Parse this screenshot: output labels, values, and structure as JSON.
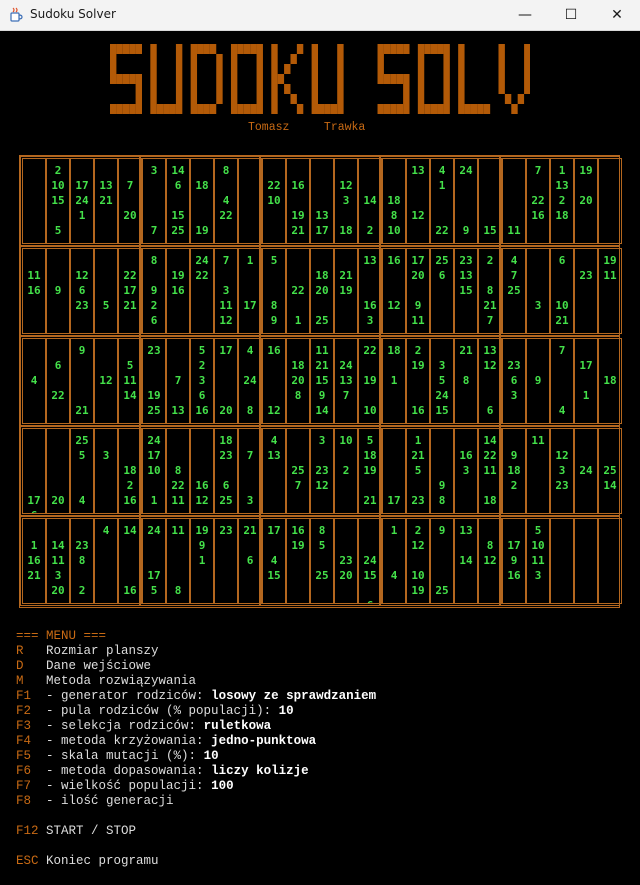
{
  "window": {
    "title": "Sudoku Solver",
    "icon": "java-cup-icon",
    "controls": {
      "minimize": "—",
      "maximize": "☐",
      "close": "✕"
    }
  },
  "banner": {
    "text": "SUDOKU SOLVER",
    "author": "Tomasz     Trawka",
    "color": "#b35a07"
  },
  "board": {
    "grid_color": "#b4671f",
    "value_color": "#44e14a",
    "rows": [
      [
        [
          [],
          [
            "2",
            "10",
            "15",
            "",
            "5"
          ],
          [
            "",
            "17",
            "24",
            "1"
          ],
          [
            "",
            "13",
            "21"
          ],
          [
            "",
            "7",
            "",
            "20"
          ],
          [
            "3",
            "",
            "",
            "",
            "7"
          ],
          [
            "14",
            "6",
            "",
            "15",
            "25"
          ],
          [
            "",
            "18",
            "",
            "",
            "19"
          ],
          [
            "8",
            "",
            "4",
            "22"
          ],
          []
        ],
        [
          [
            "",
            "22",
            "10"
          ],
          [
            "",
            "16",
            "",
            "19",
            "21"
          ],
          [
            "",
            "",
            "",
            "13",
            "17"
          ],
          [
            "",
            "12",
            "3",
            "",
            "18"
          ],
          [
            "",
            "",
            "14",
            "",
            "2"
          ],
          [
            "",
            "",
            "18",
            "8",
            "10"
          ],
          [
            "13",
            "",
            "",
            "12"
          ],
          [
            "4",
            "1",
            "",
            "",
            "22"
          ],
          [
            "24",
            "",
            "",
            "",
            "9"
          ],
          [
            "",
            "",
            "",
            "",
            "15"
          ]
        ],
        [
          [
            "",
            "",
            "",
            "",
            "11"
          ],
          [
            "7",
            "",
            "22",
            "16"
          ],
          [
            "1",
            "13",
            "2",
            "18"
          ],
          [
            "19",
            "",
            "20"
          ],
          []
        ]
      ],
      [
        [
          [
            "",
            "11",
            "16"
          ],
          [
            "",
            "",
            "9"
          ],
          [
            "",
            "12",
            "6",
            "23"
          ],
          [
            "",
            "",
            "",
            "5"
          ],
          [
            "",
            "22",
            "17",
            "21"
          ],
          [
            "8",
            "",
            "9",
            "2",
            "6"
          ],
          [
            "",
            "19",
            "16"
          ],
          [
            "24",
            "22"
          ],
          [
            "7",
            "",
            "3",
            "11",
            "12"
          ],
          [
            "1",
            "",
            "",
            "17"
          ]
        ],
        [
          [
            "5",
            "",
            "",
            "8",
            "9"
          ],
          [
            "",
            "",
            "22",
            "",
            "1"
          ],
          [
            "",
            "18",
            "20",
            "",
            "25"
          ],
          [
            "",
            "21",
            "19"
          ],
          [
            "13",
            "",
            "",
            "16",
            "3"
          ],
          [
            "16",
            "",
            "",
            "12"
          ],
          [
            "17",
            "20",
            "",
            "9",
            "11"
          ],
          [
            "25",
            "6"
          ],
          [
            "23",
            "13",
            "15"
          ],
          [
            "2",
            "",
            "8",
            "21",
            "7"
          ]
        ],
        [
          [
            "4",
            "7",
            "25"
          ],
          [
            "",
            "",
            "",
            "3"
          ],
          [
            "6",
            "",
            "",
            "10",
            "21"
          ],
          [
            "",
            "23"
          ],
          [
            "19",
            "11"
          ]
        ]
      ],
      [
        [
          [
            "",
            "",
            "4"
          ],
          [
            "",
            "6",
            "",
            "22"
          ],
          [
            "9",
            "",
            "",
            "",
            "21"
          ],
          [
            "",
            "",
            "12"
          ],
          [
            "",
            "5",
            "11",
            "14"
          ],
          [
            "23",
            "",
            "",
            "19",
            "25"
          ],
          [
            "",
            "",
            "7",
            "",
            "13"
          ],
          [
            "5",
            "2",
            "3",
            "6",
            "16"
          ],
          [
            "17",
            "",
            "",
            "",
            "20"
          ],
          [
            "4",
            "",
            "24",
            "",
            "8"
          ]
        ],
        [
          [
            "16",
            "",
            "",
            "",
            "12"
          ],
          [
            "",
            "18",
            "20",
            "8"
          ],
          [
            "11",
            "21",
            "15",
            "9",
            "14"
          ],
          [
            "",
            "24",
            "13",
            "7"
          ],
          [
            "22",
            "",
            "19",
            "",
            "10"
          ],
          [
            "18",
            "",
            "1"
          ],
          [
            "2",
            "19",
            "",
            "",
            "16"
          ],
          [
            "",
            "3",
            "5",
            "24",
            "15"
          ],
          [
            "21",
            "",
            "8"
          ],
          [
            "13",
            "12",
            "",
            "",
            "6"
          ]
        ],
        [
          [
            "",
            "23",
            "6",
            "3"
          ],
          [
            "",
            "",
            "9"
          ],
          [
            "7",
            "",
            "",
            "",
            "4"
          ],
          [
            "",
            "17",
            "",
            "1"
          ],
          [
            "",
            "",
            "18"
          ]
        ]
      ],
      [
        [
          [
            "",
            "",
            "",
            "",
            "17",
            "6"
          ],
          [
            "",
            "",
            "",
            "",
            "20"
          ],
          [
            "25",
            "5",
            "",
            "",
            "4"
          ],
          [
            "",
            "3"
          ],
          [
            "",
            "",
            "18",
            "2",
            "16"
          ],
          [
            "24",
            "17",
            "10",
            "",
            "1"
          ],
          [
            "",
            "",
            "8",
            "22",
            "11"
          ],
          [
            "",
            "",
            "",
            "16",
            "12"
          ],
          [
            "18",
            "23",
            "",
            "6",
            "25"
          ],
          [
            "",
            "7",
            "",
            "",
            "3"
          ]
        ],
        [
          [
            "4",
            "13"
          ],
          [
            "",
            "",
            "25",
            "7"
          ],
          [
            "3",
            "",
            "23",
            "12"
          ],
          [
            "10",
            "",
            "2"
          ],
          [
            "5",
            "18",
            "19",
            "",
            "21"
          ],
          [
            "",
            "",
            "",
            "",
            "17"
          ],
          [
            "1",
            "21",
            "5",
            "",
            "23"
          ],
          [
            "",
            "",
            "",
            "9",
            "8"
          ],
          [
            "",
            "16",
            "3"
          ],
          [
            "14",
            "22",
            "11",
            "",
            "18"
          ]
        ],
        [
          [
            "",
            "9",
            "18",
            "2"
          ],
          [
            "11"
          ],
          [
            "",
            "12",
            "3",
            "23"
          ],
          [
            "",
            "",
            "24"
          ],
          [
            "",
            "",
            "25",
            "14"
          ]
        ]
      ],
      [
        [
          [
            "",
            "1",
            "16",
            "21"
          ],
          [
            "",
            "14",
            "11",
            "3",
            "20"
          ],
          [
            "",
            "23",
            "8",
            "",
            "2"
          ],
          [
            "4"
          ],
          [
            "14",
            "",
            "",
            "",
            "16"
          ],
          [
            "24",
            "",
            "",
            "17",
            "5"
          ],
          [
            "11",
            "",
            "",
            "",
            "8"
          ],
          [
            "19",
            "9",
            "1"
          ],
          [
            "23"
          ],
          [
            "21",
            "",
            "6"
          ]
        ],
        [
          [
            "17",
            "",
            "4",
            "15"
          ],
          [
            "16",
            "19"
          ],
          [
            "8",
            "5",
            "",
            "25"
          ],
          [
            "",
            "",
            "23",
            "20"
          ],
          [
            "",
            "",
            "24",
            "15",
            "",
            "6"
          ],
          [
            "1",
            "",
            "",
            "4"
          ],
          [
            "2",
            "12",
            "",
            "10",
            "19"
          ],
          [
            "9",
            "",
            "",
            "",
            "25"
          ],
          [
            "13",
            "",
            "14"
          ],
          [
            "",
            "8",
            "12"
          ]
        ],
        [
          [
            "",
            "17",
            "9",
            "16"
          ],
          [
            "5",
            "10",
            "11",
            "3"
          ],
          [],
          [],
          []
        ]
      ]
    ]
  },
  "menu": {
    "title": "=== MENU ===",
    "items": [
      {
        "key": "R",
        "label": "Rozmiar planszy",
        "value": ""
      },
      {
        "key": "D",
        "label": "Dane wejściowe",
        "value": ""
      },
      {
        "key": "M",
        "label": "Metoda rozwiązywania",
        "value": ""
      },
      {
        "key": "F1",
        "label": "- generator rodziców: ",
        "value": "losowy ze sprawdzaniem"
      },
      {
        "key": "F2",
        "label": "- pula rodziców (% populacji): ",
        "value": "10"
      },
      {
        "key": "F3",
        "label": "- selekcja rodziców: ",
        "value": "ruletkowa"
      },
      {
        "key": "F4",
        "label": "- metoda krzyżowania: ",
        "value": "jedno-punktowa"
      },
      {
        "key": "F5",
        "label": "- skala mutacji (%): ",
        "value": "10"
      },
      {
        "key": "F6",
        "label": "- metoda dopasowania: ",
        "value": "liczy kolizje"
      },
      {
        "key": "F7",
        "label": "- wielkość populacji: ",
        "value": "100"
      },
      {
        "key": "F8",
        "label": "- ilość generacji",
        "value": ""
      }
    ],
    "start": {
      "key": "F12",
      "label": "START / STOP"
    },
    "exit": {
      "key": "ESC",
      "label": "Koniec programu"
    }
  }
}
